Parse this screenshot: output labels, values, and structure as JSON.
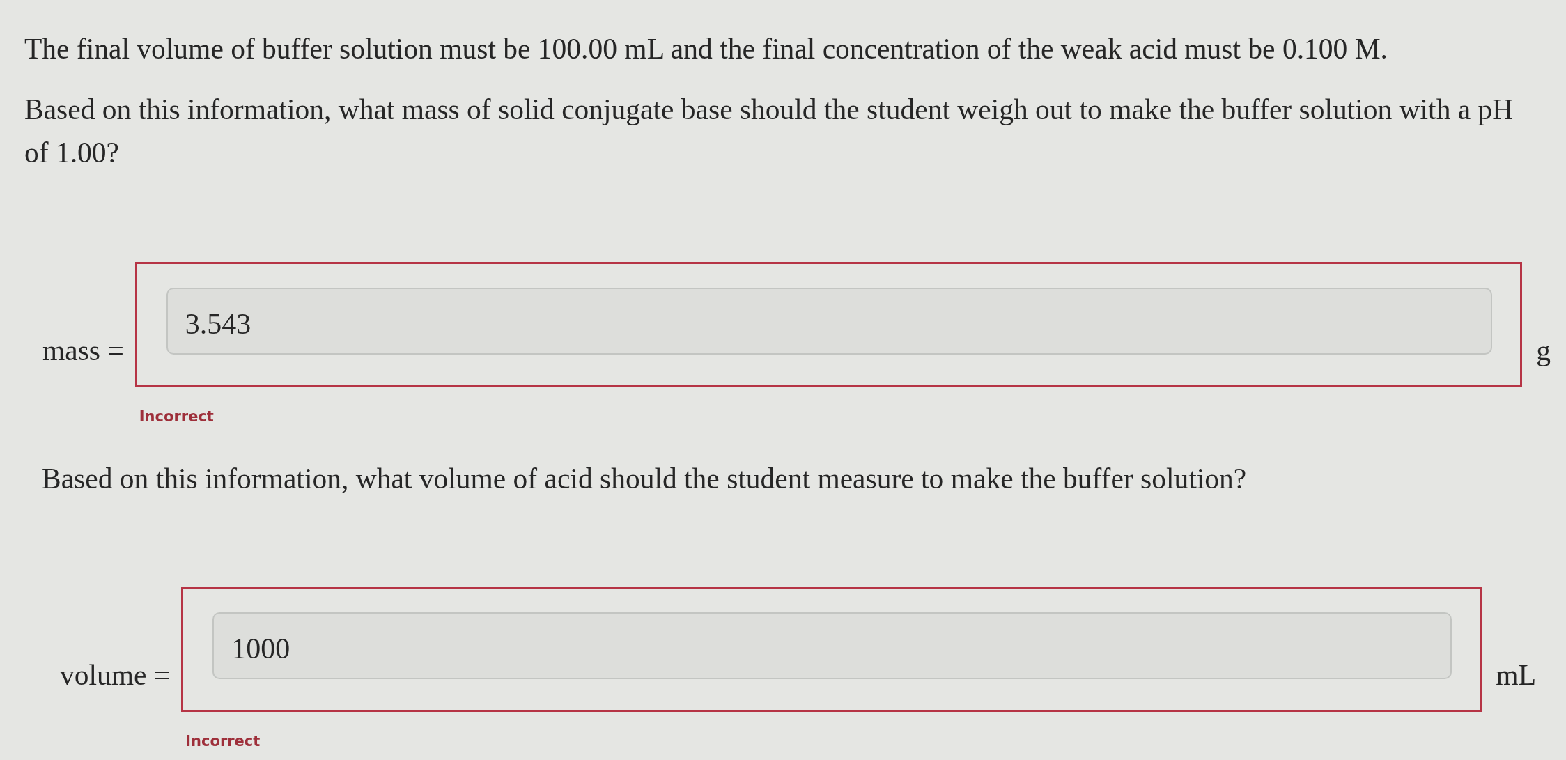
{
  "intro": "The final volume of buffer solution must be 100.00 mL and the final concentration of the weak acid must be 0.100 M.",
  "questions": [
    {
      "prompt": "Based on this information, what mass of solid conjugate base should the student weigh out to make the buffer solution with a pH of 1.00?",
      "answer": {
        "label": "mass =",
        "value": "3.543",
        "unit": "g",
        "correct": false,
        "feedback": "Incorrect"
      }
    },
    {
      "prompt": "Based on this information, what volume of acid should the student measure to make the buffer solution?",
      "answer": {
        "label": "volume =",
        "value": "1000",
        "unit": "mL",
        "correct": false,
        "feedback": "Incorrect"
      }
    }
  ]
}
